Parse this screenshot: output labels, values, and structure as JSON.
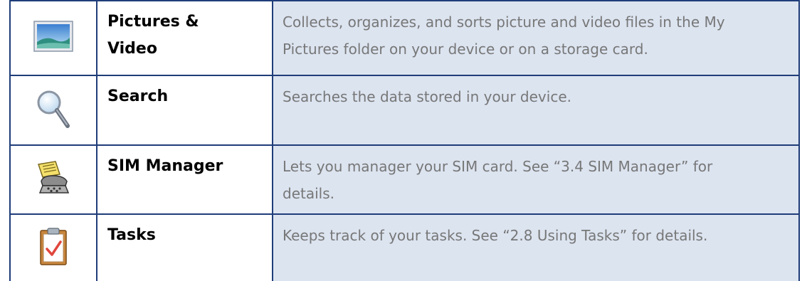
{
  "rows": [
    {
      "icon": "pictures-video-icon",
      "name": "Pictures & Video",
      "name_line1": "Pictures &",
      "name_line2": "Video",
      "description": "Collects, organizes, and sorts picture and video files in the My Pictures folder on your device or on a storage card.",
      "desc_line1": "Collects, organizes, and sorts picture and video files in the My",
      "desc_line2": "Pictures folder on your device or on a storage card."
    },
    {
      "icon": "search-magnifier-icon",
      "name": "Search",
      "description": "Searches the data stored in your device."
    },
    {
      "icon": "sim-manager-phone-icon",
      "name": "SIM Manager",
      "description": "Lets you manager your SIM card. See “3.4 SIM Manager” for details.",
      "desc_line1": "Lets you manager your SIM card. See “3.4 SIM Manager” for",
      "desc_line2": "details."
    },
    {
      "icon": "tasks-clipboard-icon",
      "name": "Tasks",
      "description": "Keeps track of your tasks. See “2.8 Using Tasks” for details."
    }
  ],
  "colors": {
    "border": "#1f3d79",
    "description_background": "#dce4f0",
    "description_text": "#777777"
  }
}
